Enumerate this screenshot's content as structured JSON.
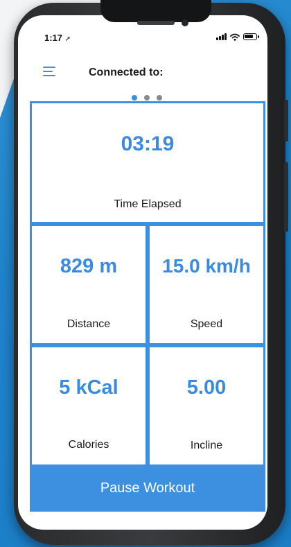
{
  "status_bar": {
    "time": "1:17"
  },
  "header": {
    "title": "Connected to:"
  },
  "pager": {
    "count": 3,
    "active_index": 0
  },
  "metrics": {
    "time_elapsed": {
      "value": "03:19",
      "label": "Time Elapsed"
    },
    "distance": {
      "value": "829 m",
      "label": "Distance"
    },
    "speed": {
      "value": "15.0 km/h",
      "label": "Speed"
    },
    "calories": {
      "value": "5 kCal",
      "label": "Calories"
    },
    "incline": {
      "value": "5.00",
      "label": "Incline"
    }
  },
  "action": {
    "pause_label": "Pause Workout"
  },
  "colors": {
    "accent": "#3d8fdf",
    "value_text": "#3a8be0",
    "background_blue": "#1f84cc"
  }
}
